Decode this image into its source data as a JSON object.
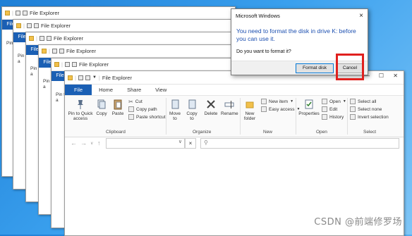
{
  "explorer": {
    "title": "File Explorer",
    "stack_side_text": "Pin t",
    "stack_side_text2": "a",
    "tabs": [
      "File",
      "Home",
      "Share",
      "View"
    ],
    "ribbon": {
      "pin_quick_access": "Pin to Quick",
      "pin_quick_access2": "access",
      "copy": "Copy",
      "paste": "Paste",
      "cut": "Cut",
      "copy_path": "Copy path",
      "paste_shortcut": "Paste shortcut",
      "move_to": "Move",
      "move_to2": "to",
      "copy_to": "Copy",
      "copy_to2": "to",
      "delete": "Delete",
      "rename": "Rename",
      "new_folder": "New",
      "new_folder2": "folder",
      "new_item": "New item",
      "easy_access": "Easy access",
      "properties": "Properties",
      "open": "Open",
      "edit": "Edit",
      "history": "History",
      "select_all": "Select all",
      "select_none": "Select none",
      "invert_selection": "Invert selection",
      "groups": [
        "Clipboard",
        "Organize",
        "New",
        "Open",
        "Select"
      ]
    },
    "address_clear": "×"
  },
  "dialog": {
    "title": "Microsoft Windows",
    "message": "You need to format the disk in drive K: before you can use it.",
    "question": "Do you want to format it?",
    "format_button": "Format disk",
    "cancel_button": "Cancel",
    "close": "×"
  },
  "watermark": "CSDN @前端修罗场",
  "colors": {
    "accent_blue": "#1a5fb4",
    "dialog_text": "#1c4fb0",
    "highlight_red": "#e0201e"
  }
}
